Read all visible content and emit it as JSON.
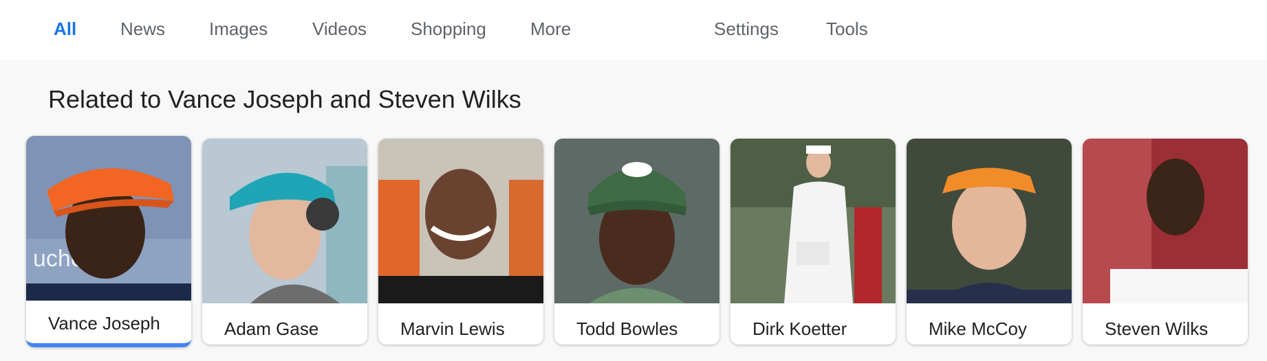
{
  "tabs": {
    "all": "All",
    "news": "News",
    "images": "Images",
    "videos": "Videos",
    "shopping": "Shopping",
    "more": "More",
    "settings": "Settings",
    "tools": "Tools"
  },
  "related": {
    "title": "Related to Vance Joseph and Steven Wilks",
    "people": [
      {
        "name": "Vance Joseph"
      },
      {
        "name": "Adam Gase"
      },
      {
        "name": "Marvin Lewis"
      },
      {
        "name": "Todd Bowles"
      },
      {
        "name": "Dirk Koetter"
      },
      {
        "name": "Mike McCoy"
      },
      {
        "name": "Steven Wilks"
      }
    ]
  },
  "colors": {
    "accent": "#1a73e8",
    "selected_underline": "#4285f4"
  }
}
